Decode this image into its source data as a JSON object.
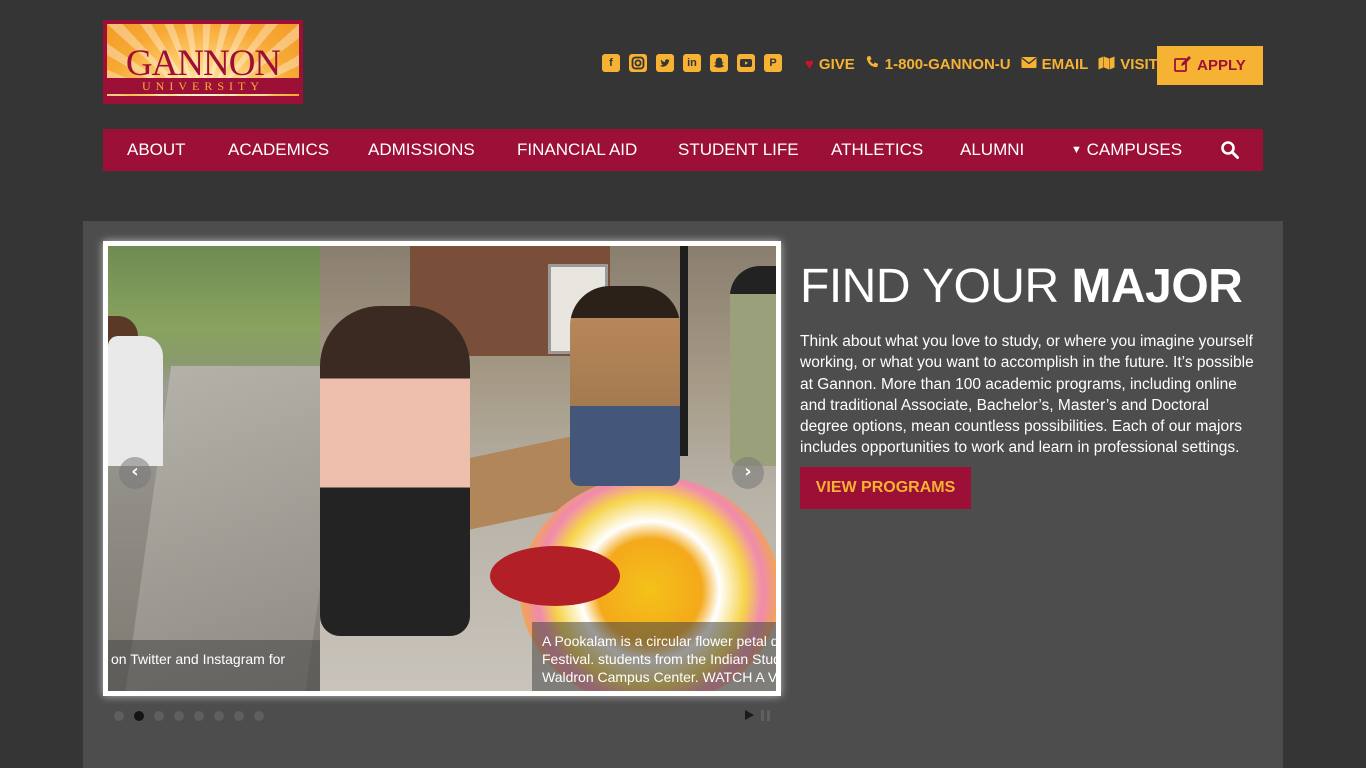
{
  "logo": {
    "title": "GANNON",
    "subtitle": "UNIVERSITY"
  },
  "colors": {
    "background": "#353535",
    "panel": "#4d4d4d",
    "brand_maroon": "#9c0f36",
    "brand_gold": "#f6b233"
  },
  "social_icons": [
    "facebook-icon",
    "instagram-icon",
    "twitter-icon",
    "linkedin-icon",
    "snapchat-icon",
    "youtube-icon",
    "pinterest-icon"
  ],
  "utility": {
    "give": "GIVE",
    "phone": "1-800-GANNON-U",
    "email": "EMAIL",
    "visit": "VISIT",
    "apply": "APPLY"
  },
  "nav": {
    "items": [
      "ABOUT",
      "ACADEMICS",
      "ADMISSIONS",
      "FINANCIAL AID",
      "STUDENT LIFE",
      "ATHLETICS",
      "ALUMNI",
      "CAMPUSES"
    ]
  },
  "carousel": {
    "caption_left": "on Twitter and Instagram for",
    "caption_main": [
      "A Pookalam is a circular flower petal design or sculpture created in",
      "Festival. students from the Indian Student Association crafted a Po",
      "Waldron Campus Center. WATCH A VIDEO OF THEIR EXPERIEN"
    ],
    "slide_count": 8,
    "active_slide": 2
  },
  "feature": {
    "heading_light": "FIND YOUR ",
    "heading_bold": "MAJOR",
    "body": "Think about what you love to study, or where you imagine yourself working, or what you want to accomplish in the future. It’s possible at Gannon. More than 100 academic programs, including online and traditional Associate, Bachelor’s, Master’s and Doctoral degree options, mean countless possibilities. Each of our majors includes opportunities to work and learn in professional settings.",
    "cta": "VIEW PROGRAMS"
  }
}
